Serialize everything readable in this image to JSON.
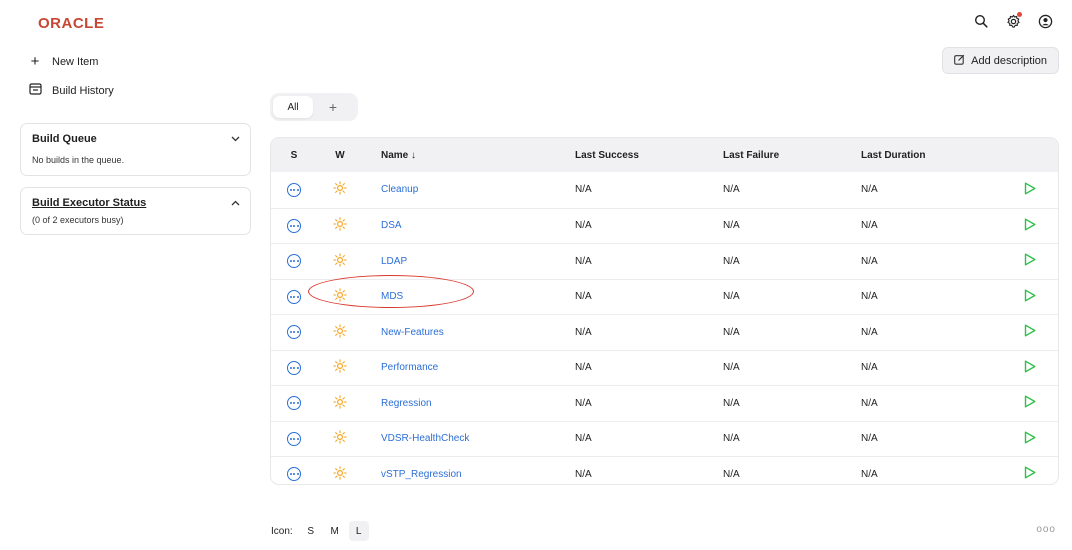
{
  "app": {
    "logo_text": "ORACLE",
    "logo_color": "#c74634"
  },
  "header_icons": [
    "search-icon",
    "gear-icon",
    "user-icon"
  ],
  "sidebar": {
    "links": [
      {
        "label": "New Item",
        "icon": "plus-icon"
      },
      {
        "label": "Build History",
        "icon": "history-icon"
      }
    ],
    "build_queue": {
      "title": "Build Queue",
      "body": "No builds in the queue."
    },
    "executor_status": {
      "title": "Build Executor Status",
      "body": "(0 of 2 executors busy)"
    }
  },
  "actions": {
    "add_description": "Add description"
  },
  "tabs": {
    "all": "All",
    "add": "+"
  },
  "table": {
    "headers": {
      "s": "S",
      "w": "W",
      "name": "Name ↓",
      "last_success": "Last Success",
      "last_failure": "Last Failure",
      "last_duration": "Last Duration"
    },
    "rows": [
      {
        "name": "Cleanup",
        "last_success": "N/A",
        "last_failure": "N/A",
        "last_duration": "N/A"
      },
      {
        "name": "DSA",
        "last_success": "N/A",
        "last_failure": "N/A",
        "last_duration": "N/A"
      },
      {
        "name": "LDAP",
        "last_success": "N/A",
        "last_failure": "N/A",
        "last_duration": "N/A"
      },
      {
        "name": "MDS",
        "last_success": "N/A",
        "last_failure": "N/A",
        "last_duration": "N/A"
      },
      {
        "name": "New-Features",
        "last_success": "N/A",
        "last_failure": "N/A",
        "last_duration": "N/A"
      },
      {
        "name": "Performance",
        "last_success": "N/A",
        "last_failure": "N/A",
        "last_duration": "N/A"
      },
      {
        "name": "Regression",
        "last_success": "N/A",
        "last_failure": "N/A",
        "last_duration": "N/A"
      },
      {
        "name": "VDSR-HealthCheck",
        "last_success": "N/A",
        "last_failure": "N/A",
        "last_duration": "N/A"
      },
      {
        "name": "vSTP_Regression",
        "last_success": "N/A",
        "last_failure": "N/A",
        "last_duration": "N/A"
      }
    ]
  },
  "footer": {
    "icon_label": "Icon:",
    "sizes": [
      "S",
      "M",
      "L"
    ],
    "active_size": "L",
    "more": "ooo"
  },
  "colors": {
    "link": "#2b6fd6",
    "run": "#2fbf4a",
    "weather": "#f5a623",
    "highlight": "#d9372b"
  }
}
